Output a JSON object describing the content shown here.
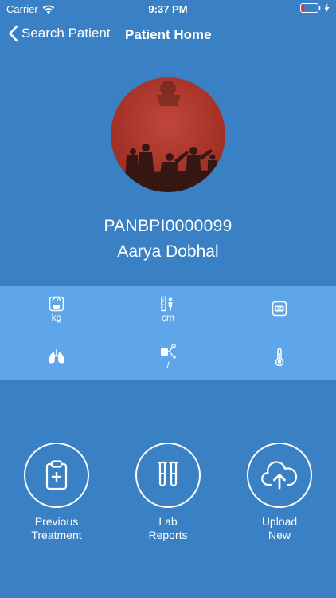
{
  "status_bar": {
    "carrier": "Carrier",
    "time": "9:37 PM"
  },
  "nav": {
    "back_label": "Search Patient",
    "title": "Patient Home"
  },
  "patient": {
    "id": "PANBPI0000099",
    "name": "Aarya Dobhal"
  },
  "vitals": [
    {
      "icon": "weight-scale-icon",
      "unit": "kg"
    },
    {
      "icon": "height-icon",
      "unit": "cm"
    },
    {
      "icon": "bmi-scale-icon",
      "unit": ""
    },
    {
      "icon": "lungs-icon",
      "unit": ""
    },
    {
      "icon": "blood-pressure-icon",
      "unit": "/"
    },
    {
      "icon": "thermometer-icon",
      "unit": ""
    }
  ],
  "actions": {
    "previous_treatment": "Previous\nTreatment",
    "lab_reports": "Lab\nReports",
    "upload_new": "Upload\nNew"
  },
  "colors": {
    "background": "#3a80c4",
    "vitals_strip": "#5ea6e9",
    "avatar_red": "#b53a2e",
    "battery_low": "#e0323c"
  }
}
